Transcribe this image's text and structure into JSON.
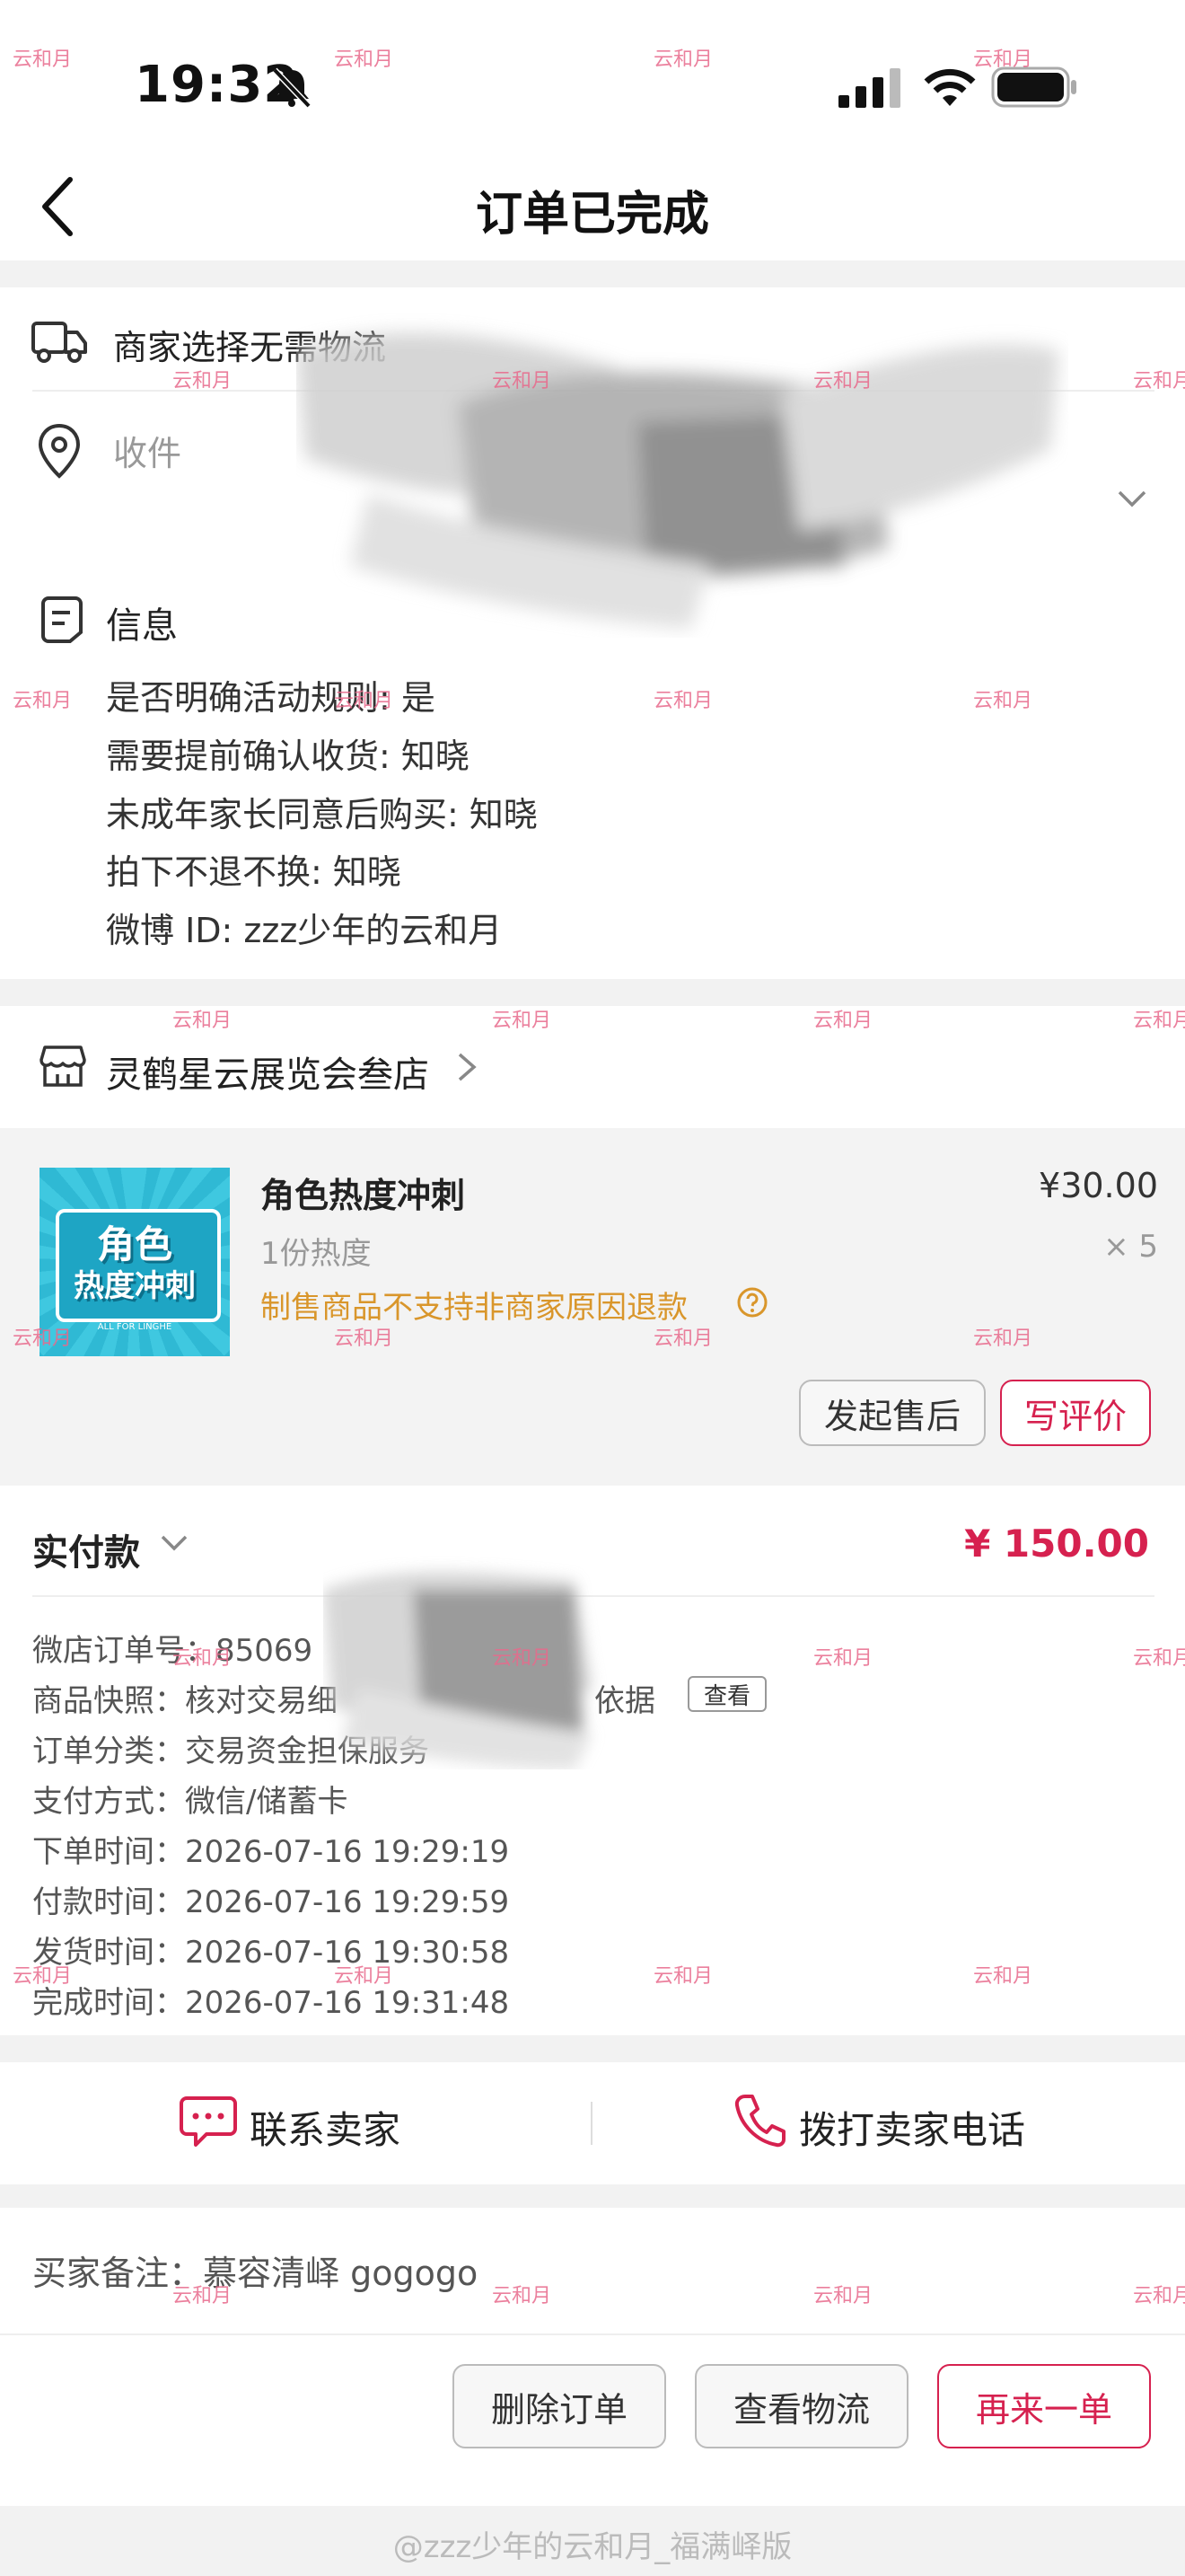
{
  "status_bar": {
    "time": "19:32"
  },
  "nav": {
    "title": "订单已完成"
  },
  "delivery": {
    "label": "商家选择无需物流",
    "address_label": "收件"
  },
  "info": {
    "title": "信息",
    "lines": [
      "是否明确活动规则: 是",
      "需要提前确认收货: 知晓",
      "未成年家长同意后购买: 知晓",
      "拍下不退不换: 知晓",
      "微博 ID: zzz少年的云和月"
    ]
  },
  "shop": {
    "name": "灵鹤星云展览会叁店"
  },
  "product": {
    "thumb_text_1": "角色",
    "thumb_text_2": "热度冲刺",
    "thumb_small": "ALL FOR LINGHE",
    "name": "角色热度冲刺",
    "price": "¥30.00",
    "spec": "1份热度",
    "qty": "× 5",
    "notice": "制售商品不支持非商家原因退款",
    "after_sale_label": "发起售后",
    "review_label": "写评价"
  },
  "payment": {
    "label": "实付款",
    "amount": "¥ 150.00",
    "order_no": "微店订单号：85069",
    "snapshot": "商品快照：核对交易细",
    "snapshot_tail": "依据",
    "view_label": "查看",
    "category": "订单分类：交易资金担保服务",
    "method": "支付方式：微信/储蓄卡",
    "times": [
      "下单时间：2026-07-16 19:29:19",
      "付款时间：2026-07-16 19:29:59",
      "发货时间：2026-07-16 19:30:58",
      "完成时间：2026-07-16 19:31:48"
    ]
  },
  "contact": {
    "chat_label": "联系卖家",
    "call_label": "拨打卖家电话"
  },
  "remark": {
    "text": "买家备注：慕容清峄 gogogo"
  },
  "bottom": {
    "delete_label": "删除订单",
    "logistics_label": "查看物流",
    "reorder_label": "再来一单"
  },
  "watermark_text": "云和月",
  "footer_watermark": "@zzz少年的云和月_福满峄版",
  "colors": {
    "accent": "#d6214f",
    "notice": "#d9962b",
    "thumb": "#2fb9d4"
  }
}
